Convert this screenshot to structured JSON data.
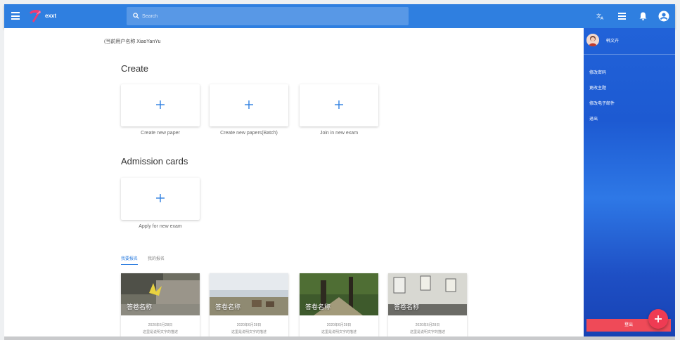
{
  "header": {
    "logo_text": "exxt",
    "search_placeholder": "Search",
    "icons": [
      "menu-icon",
      "translate-icon",
      "list-icon",
      "bell-icon",
      "account-icon"
    ],
    "color": "#2f7fe0"
  },
  "breadcrumb": "(当前用户名称 XiaoYanYu",
  "create": {
    "title": "Create",
    "cards": [
      {
        "label": "Create new paper"
      },
      {
        "label": "Create new papers(Batch)"
      },
      {
        "label": "Join in new exam"
      }
    ]
  },
  "admission": {
    "title": "Admission cards",
    "cards": [
      {
        "label": "Apply for new exam"
      }
    ]
  },
  "tabs": [
    {
      "label": "我要报名",
      "active": true
    },
    {
      "label": "我的报名",
      "active": false
    }
  ],
  "exams": [
    {
      "name": "答卷名称",
      "date": "2020年6月28日",
      "desc": "这里是说明文字的描述"
    },
    {
      "name": "答卷名称",
      "date": "2020年6月28日",
      "desc": "这里是说明文字的描述"
    },
    {
      "name": "答卷名称",
      "date": "2020年6月28日",
      "desc": "这里是说明文字的描述"
    },
    {
      "name": "答卷名称",
      "date": "2020年6月28日",
      "desc": "这里是说明文字的描述"
    }
  ],
  "right_panel": {
    "user_name": "韩文卉",
    "items": [
      "修改密码",
      "更改主题",
      "修改电子邮件",
      "退出"
    ],
    "bottom_button": "登出",
    "accent": "#ef4a58"
  }
}
